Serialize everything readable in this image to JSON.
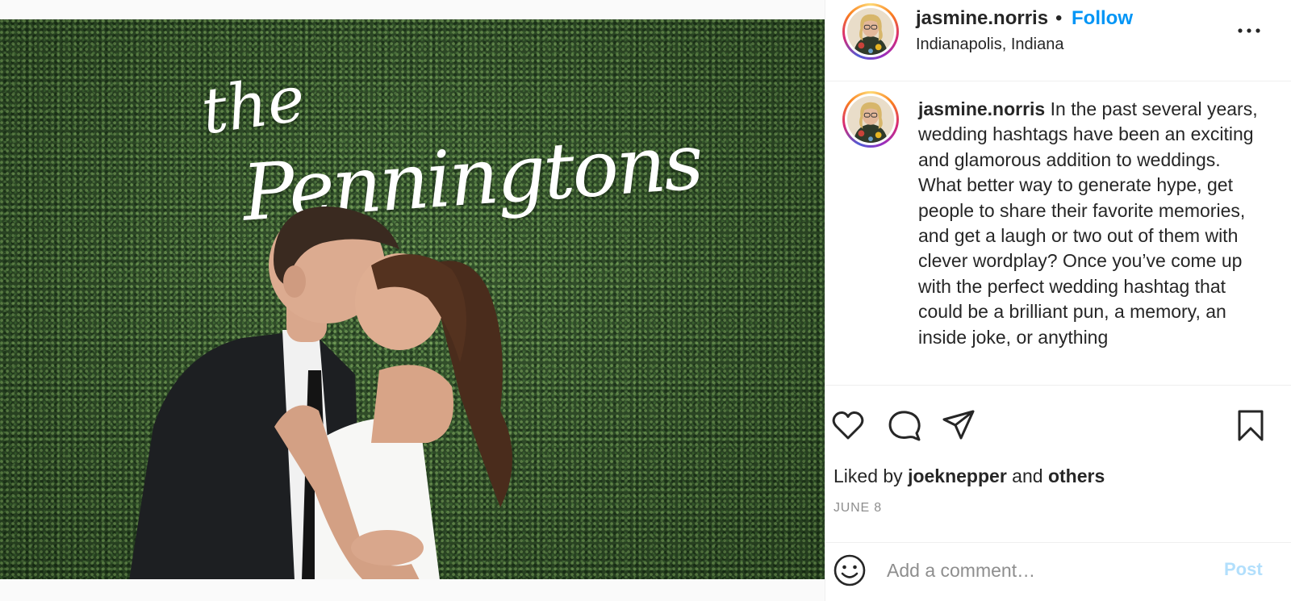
{
  "post": {
    "photo": {
      "sign_line1": "the",
      "sign_line2": "Penningtons"
    },
    "header": {
      "username": "jasmine.norris",
      "separator": "•",
      "follow_label": "Follow",
      "location": "Indianapolis, Indiana",
      "more_icon": "more-horizontal-icon"
    },
    "caption": {
      "username": "jasmine.norris",
      "text": " In the past several years, wedding hashtags have been an exciting and glamorous addition to weddings. What better way to generate hype, get people to share their favorite memories, and get a laugh or two out of them with clever wordplay? Once you’ve come up with the perfect wedding hashtag that could be a brilliant pun, a memory, an inside joke, or anything"
    },
    "actions": {
      "like_icon": "heart-icon",
      "comment_icon": "comment-icon",
      "share_icon": "paper-plane-icon",
      "save_icon": "bookmark-icon"
    },
    "likes": {
      "prefix": "Liked by ",
      "user": "joeknepper",
      "conjunction": " and ",
      "others": "others"
    },
    "date": "JUNE 8",
    "comment": {
      "emoji_icon": "smiley-icon",
      "placeholder": "Add a comment…",
      "post_label": "Post"
    }
  },
  "colors": {
    "link_blue": "#0095f6",
    "post_disabled": "#b2dffc",
    "muted_gray": "#8e8e8e",
    "text": "#262626",
    "divider": "#efefef"
  }
}
